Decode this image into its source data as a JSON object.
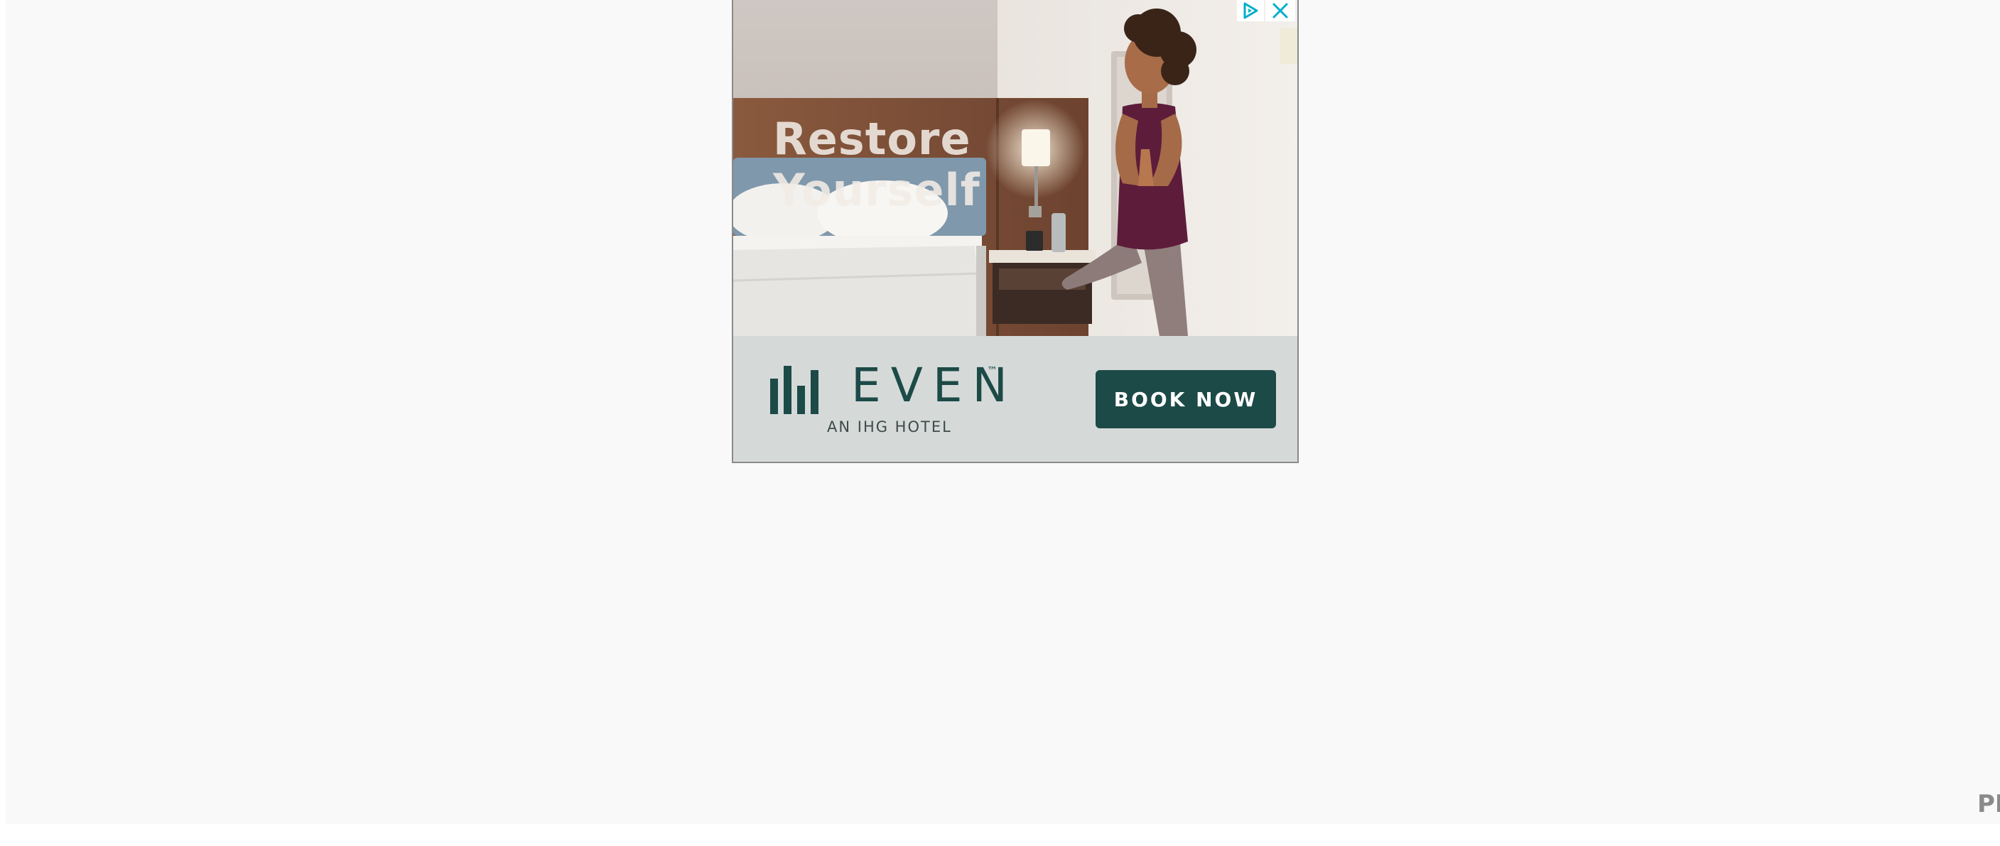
{
  "ad": {
    "headline_line1": "Restore",
    "headline_line2": "Yourself",
    "brand_name": "EVEN",
    "brand_trademark": "™",
    "brand_tagline": "AN IHG HOTEL",
    "cta_label": "BOOK NOW",
    "adchoices_icon": "adchoices-icon",
    "close_icon": "close-icon"
  },
  "page": {
    "corner_mark_text": "PN"
  },
  "colors": {
    "brand_green": "#1c4a47",
    "adchoices_cyan": "#00aecd",
    "page_background": "#f9f9f9",
    "footer_background": "#d5dad9"
  }
}
